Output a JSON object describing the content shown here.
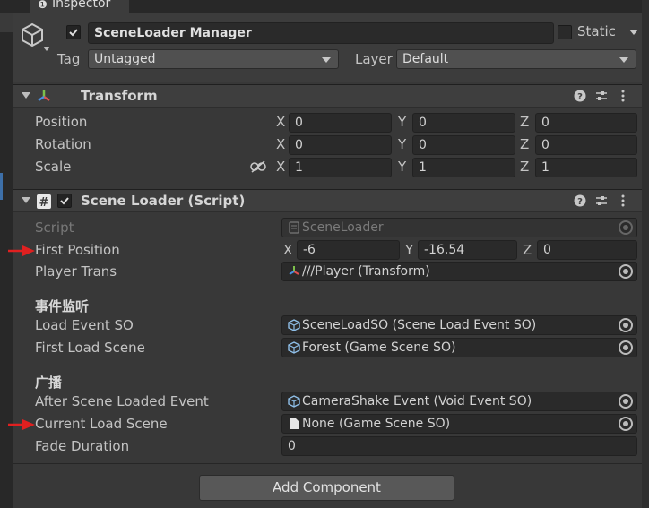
{
  "window": {
    "tab_title": "Inspector",
    "tab_icon": "info-icon"
  },
  "header": {
    "object_name": "SceneLoader Manager",
    "active": true,
    "static_label": "Static",
    "static_checked": false,
    "tag_label": "Tag",
    "tag_value": "Untagged",
    "layer_label": "Layer",
    "layer_value": "Default"
  },
  "transform": {
    "title": "Transform",
    "rows": [
      {
        "label": "Position",
        "x": "0",
        "y": "0",
        "z": "0"
      },
      {
        "label": "Rotation",
        "x": "0",
        "y": "0",
        "z": "0"
      },
      {
        "label": "Scale",
        "x": "1",
        "y": "1",
        "z": "1"
      }
    ],
    "axis_x": "X",
    "axis_y": "Y",
    "axis_z": "Z"
  },
  "scene_loader": {
    "title": "Scene Loader (Script)",
    "enabled": true,
    "script_label": "Script",
    "script_value": "SceneLoader",
    "first_position_label": "First Position",
    "first_position": {
      "x": "-6",
      "y": "-16.54",
      "z": "0"
    },
    "player_trans_label": "Player Trans",
    "player_trans_value": "///Player (Transform)",
    "section_events": "事件监听",
    "load_event_label": "Load Event SO",
    "load_event_value": "SceneLoadSO (Scene Load Event SO)",
    "first_load_scene_label": "First Load Scene",
    "first_load_scene_value": "Forest (Game Scene SO)",
    "section_broadcast": "广播",
    "after_scene_loaded_label": "After Scene Loaded Event",
    "after_scene_loaded_value": "CameraShake Event (Void Event SO)",
    "current_load_scene_label": "Current Load Scene",
    "current_load_scene_value": "None (Game Scene SO)",
    "fade_duration_label": "Fade Duration",
    "fade_duration_value": "0"
  },
  "add_component_label": "Add Component",
  "colors": {
    "annotation_arrow": "#e02020",
    "background": "#383838",
    "field": "#2a2a2a"
  }
}
